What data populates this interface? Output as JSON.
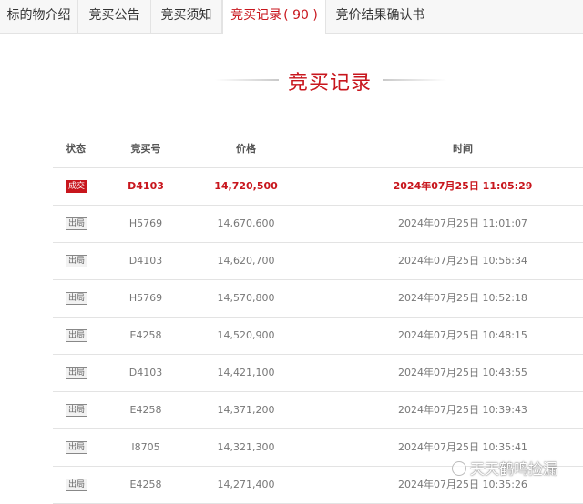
{
  "tabs": [
    {
      "label": "标的物介绍"
    },
    {
      "label": "竞买公告"
    },
    {
      "label": "竞买须知"
    },
    {
      "label": "竞买记录",
      "count": "( 90 )"
    },
    {
      "label": "竞价结果确认书"
    }
  ],
  "section_title": "竞买记录",
  "table": {
    "headers": {
      "status": "状态",
      "bidder": "竞买号",
      "price": "价格",
      "time": "时间"
    },
    "rows": [
      {
        "status": "成交",
        "bidder": "D4103",
        "price": "14,720,500",
        "time": "2024年07月25日 11:05:29"
      },
      {
        "status": "出局",
        "bidder": "H5769",
        "price": "14,670,600",
        "time": "2024年07月25日 11:01:07"
      },
      {
        "status": "出局",
        "bidder": "D4103",
        "price": "14,620,700",
        "time": "2024年07月25日 10:56:34"
      },
      {
        "status": "出局",
        "bidder": "H5769",
        "price": "14,570,800",
        "time": "2024年07月25日 10:52:18"
      },
      {
        "status": "出局",
        "bidder": "E4258",
        "price": "14,520,900",
        "time": "2024年07月25日 10:48:15"
      },
      {
        "status": "出局",
        "bidder": "D4103",
        "price": "14,421,100",
        "time": "2024年07月25日 10:43:55"
      },
      {
        "status": "出局",
        "bidder": "E4258",
        "price": "14,371,200",
        "time": "2024年07月25日 10:39:43"
      },
      {
        "status": "出局",
        "bidder": "I8705",
        "price": "14,321,300",
        "time": "2024年07月25日 10:35:41"
      },
      {
        "status": "出局",
        "bidder": "E4258",
        "price": "14,271,400",
        "time": "2024年07月25日 10:35:26"
      }
    ]
  },
  "watermark": "天天鹤鸣捡漏",
  "colors": {
    "accent": "#c8161d",
    "border": "#e3e3e3",
    "tab_bg": "#f7f7f7"
  }
}
